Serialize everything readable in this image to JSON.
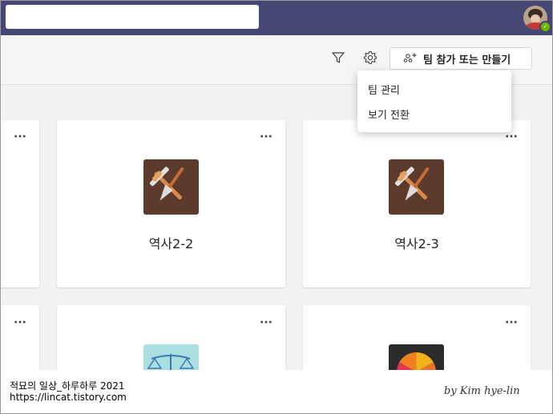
{
  "header": {
    "join_button_label": "팀 참가 또는 만들기"
  },
  "menu": {
    "items": [
      "팀 관리",
      "보기 전환"
    ]
  },
  "teams": [
    {
      "name": "역사2-2"
    },
    {
      "name": "역사2-3"
    }
  ],
  "card_more_label": "···",
  "watermark": {
    "line1": "적묘의 일상_하루하루 2021",
    "line2": "https://lincat.tistory.com",
    "signature": "by Kim hye-lin"
  }
}
